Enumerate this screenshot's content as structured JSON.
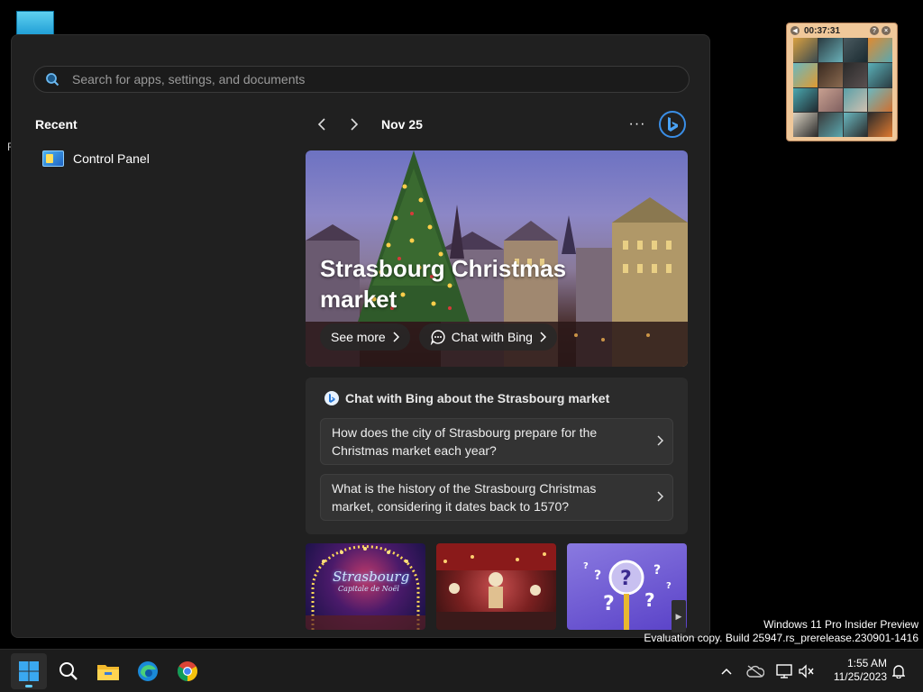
{
  "desktop": {
    "sliver_text": "F"
  },
  "puzzle": {
    "timer": "00:37:31"
  },
  "start_menu": {
    "search": {
      "placeholder": "Search for apps, settings, and documents"
    },
    "recent": {
      "heading": "Recent",
      "items": [
        {
          "label": "Control Panel",
          "icon": "control-panel-icon"
        }
      ]
    },
    "feed": {
      "date": "Nov 25",
      "more_label": "···",
      "hero": {
        "title": "Strasbourg Christmas market",
        "see_more": "See more",
        "chat_bing": "Chat with Bing"
      },
      "chat_card": {
        "heading": "Chat with Bing about the Strasbourg market",
        "questions": [
          "How does the city of Strasbourg prepare for the Christmas market each year?",
          "What is the history of the Strasbourg Christmas market, considering it dates back to 1570?"
        ]
      },
      "thumbnails": [
        {
          "caption": "Strasbourg",
          "subcaption": "Capitale de Noël"
        },
        {
          "caption": ""
        },
        {
          "caption": ""
        }
      ]
    }
  },
  "watermark": {
    "line1": "Windows 11 Pro Insider Preview",
    "line2": "Evaluation copy. Build 25947.rs_prerelease.230901-1416"
  },
  "taskbar": {
    "apps": [
      "start-icon",
      "search-icon",
      "file-explorer-icon",
      "edge-icon",
      "chrome-icon"
    ],
    "clock": {
      "time": "1:55 AM",
      "date": "11/25/2023"
    }
  },
  "colors": {
    "accent": "#60cdff",
    "menu_bg": "#202020",
    "bing_blue": "#3a8ee6"
  }
}
